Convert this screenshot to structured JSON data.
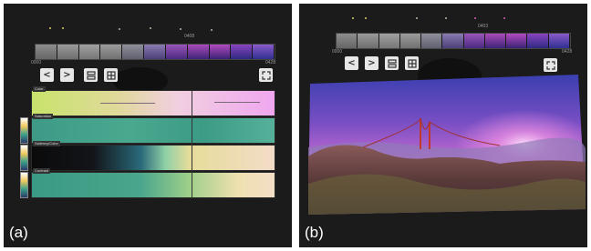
{
  "panels": [
    {
      "label": "(a)",
      "timestamp": "0408",
      "range_start": "0000",
      "range_end": "0428",
      "tracks": [
        {
          "label": "Color"
        },
        {
          "label": "Saturation"
        },
        {
          "label": "Saliency/Color"
        },
        {
          "label": "Contrast"
        }
      ]
    },
    {
      "label": "(b)",
      "timestamp": "0403",
      "range_start": "0000",
      "range_end": "0428"
    }
  ],
  "controls": {
    "prev": "<",
    "next": ">"
  },
  "icons": [
    "chevron-left-icon",
    "chevron-right-icon",
    "rows-layout-icon",
    "grid-layout-icon",
    "fullscreen-icon"
  ]
}
